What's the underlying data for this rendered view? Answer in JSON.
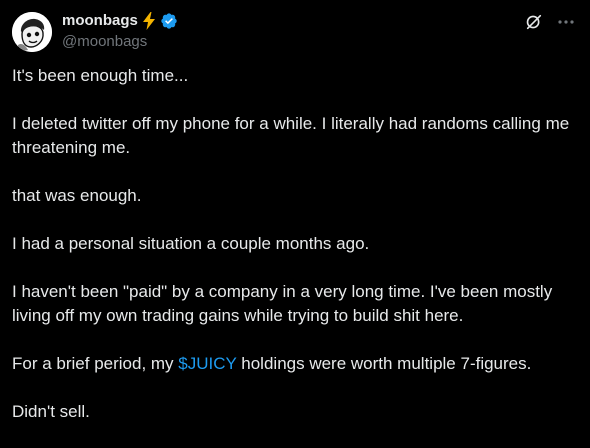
{
  "post": {
    "display_name": "moonbags",
    "handle": "@moonbags",
    "name_emoji_icon": "lightning-icon",
    "verified_icon": "verified-badge-icon",
    "actions": {
      "grok_icon": "grok-icon",
      "more_icon": "more-icon"
    },
    "paragraphs": [
      "It's been enough time...",
      "I deleted twitter off my phone for a while. I literally had randoms calling me threatening me.",
      "that was enough.",
      "I had a personal situation a couple months ago.",
      "I haven't been \"paid\" by a company in a very long time. I've been mostly living off my own trading gains while trying to build shit here."
    ],
    "cashtag_paragraph": {
      "before": "For a brief period, my ",
      "cashtag": "$JUICY",
      "after": " holdings were worth multiple 7-figures."
    },
    "last_paragraph": "Didn't sell."
  },
  "colors": {
    "background": "#000000",
    "text": "#e7e9ea",
    "secondary": "#71767b",
    "accent": "#1d9bf0",
    "lightning": "#f4b400"
  }
}
